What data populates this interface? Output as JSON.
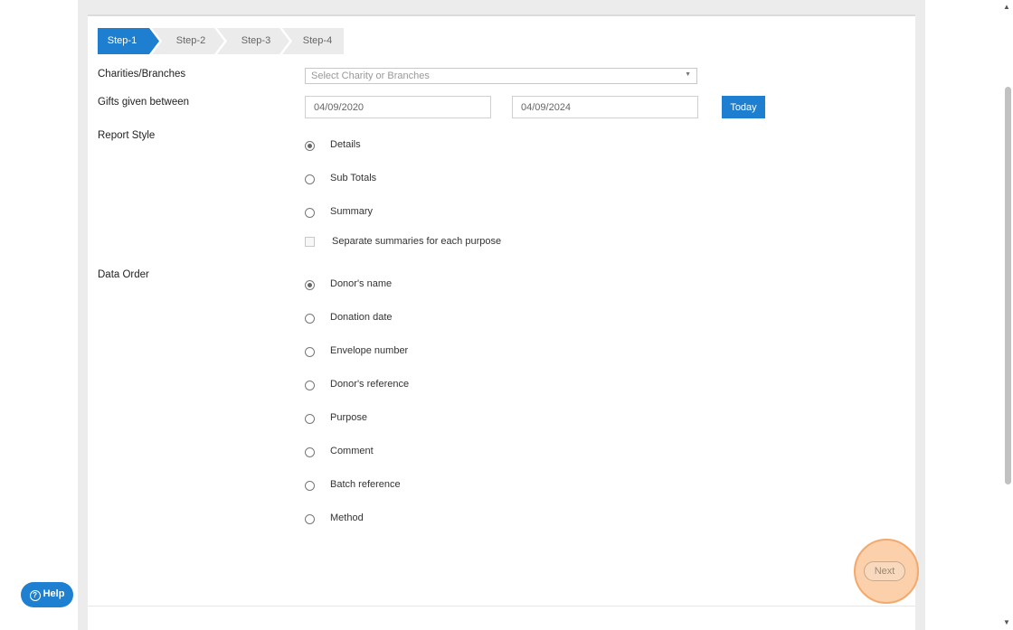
{
  "stepper": {
    "steps": [
      "Step-1",
      "Step-2",
      "Step-3",
      "Step-4"
    ],
    "active_index": 0
  },
  "form": {
    "charities_label": "Charities/Branches",
    "charities_placeholder": "Select Charity or Branches",
    "gifts_label": "Gifts given between",
    "date_from": "04/09/2020",
    "date_to": "04/09/2024",
    "today_button": "Today",
    "report_style_label": "Report Style",
    "report_style_options": [
      "Details",
      "Sub Totals",
      "Summary"
    ],
    "report_style_selected": "Details",
    "separate_summaries_label": "Separate summaries for each purpose",
    "data_order_label": "Data Order",
    "data_order_options": [
      "Donor's name",
      "Donation date",
      "Envelope number",
      "Donor's reference",
      "Purpose",
      "Comment",
      "Batch reference",
      "Method"
    ],
    "data_order_selected": "Donor's name"
  },
  "footer": {
    "next_button": "Next"
  },
  "help": {
    "label": "Help"
  },
  "colors": {
    "accent": "#1e7fd0",
    "highlight": "#f3a96c"
  }
}
